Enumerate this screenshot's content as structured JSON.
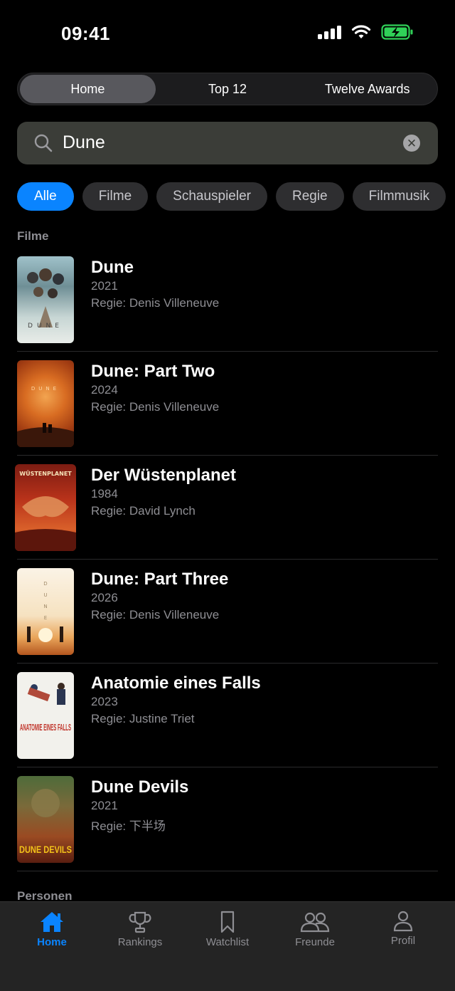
{
  "status": {
    "time": "09:41"
  },
  "segmented": {
    "tabs": [
      "Home",
      "Top 12",
      "Twelve Awards"
    ],
    "active": 0
  },
  "search": {
    "value": "Dune"
  },
  "filters": {
    "chips": [
      "Alle",
      "Filme",
      "Schauspieler",
      "Regie",
      "Filmmusik"
    ],
    "active": 0
  },
  "sections": {
    "films": "Filme",
    "people": "Personen"
  },
  "films": [
    {
      "title": "Dune",
      "year": "2021",
      "director": "Regie: Denis Villeneuve"
    },
    {
      "title": "Dune: Part Two",
      "year": "2024",
      "director": "Regie: Denis Villeneuve"
    },
    {
      "title": "Der Wüstenplanet",
      "year": "1984",
      "director": "Regie: David Lynch",
      "poster_text": "WÜSTENPLANET"
    },
    {
      "title": "Dune: Part Three",
      "year": "2026",
      "director": "Regie: Denis Villeneuve"
    },
    {
      "title": "Anatomie eines Falls",
      "year": "2023",
      "director": "Regie: Justine Triet",
      "poster_text": "ANATOMIE EINES FALLS"
    },
    {
      "title": "Dune Devils",
      "year": "2021",
      "director": "Regie: 下半场",
      "poster_text": "DUNE DEVILS"
    }
  ],
  "tabbar": {
    "items": [
      {
        "label": "Home",
        "icon": "house-icon"
      },
      {
        "label": "Rankings",
        "icon": "trophy-icon"
      },
      {
        "label": "Watchlist",
        "icon": "bookmark-icon"
      },
      {
        "label": "Freunde",
        "icon": "people-icon"
      },
      {
        "label": "Profil",
        "icon": "person-icon"
      }
    ],
    "active": 0
  },
  "colors": {
    "accent": "#0a84ff",
    "background": "#000000",
    "battery": "#30d158"
  }
}
